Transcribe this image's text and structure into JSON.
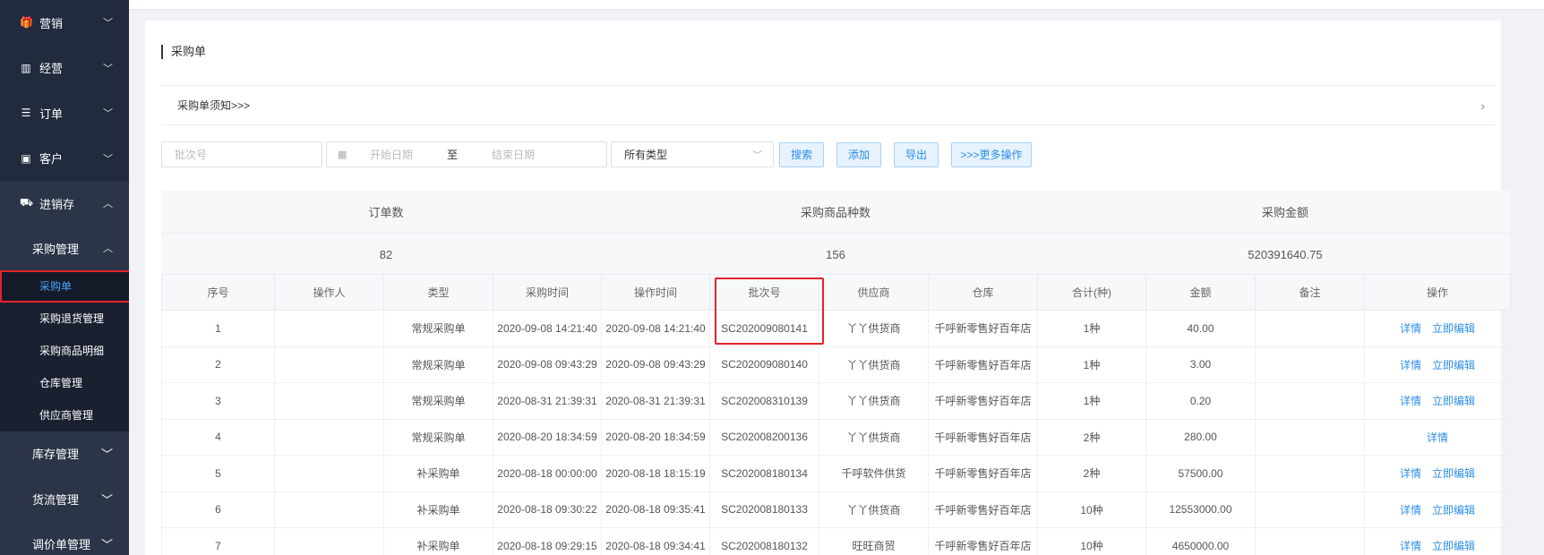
{
  "sidebar": {
    "items": [
      {
        "label": "营销",
        "icon": "gift-icon"
      },
      {
        "label": "经营",
        "icon": "bar-chart-icon"
      },
      {
        "label": "订单",
        "icon": "list-icon"
      },
      {
        "label": "客户",
        "icon": "id-card-icon"
      },
      {
        "label": "进销存",
        "icon": "truck-icon"
      }
    ],
    "purchase_group": "采购管理",
    "purchase_leaves": [
      "采购单",
      "采购退货管理",
      "采购商品明细",
      "仓库管理",
      "供应商管理"
    ],
    "bottom_groups": [
      "库存管理",
      "货流管理",
      "调价单管理"
    ]
  },
  "page": {
    "title": "采购单",
    "notice": "采购单须知>>>"
  },
  "filters": {
    "batch_placeholder": "批次号",
    "start_placeholder": "开始日期",
    "date_separator": "至",
    "end_placeholder": "结束日期",
    "type_value": "所有类型",
    "buttons": {
      "search": "搜索",
      "add": "添加",
      "export": "导出",
      "more": ">>>更多操作"
    }
  },
  "summary": {
    "headers": [
      "订单数",
      "采购商品种数",
      "采购金额"
    ],
    "values": [
      "82",
      "156",
      "520391640.75"
    ]
  },
  "table": {
    "columns": [
      "序号",
      "操作人",
      "类型",
      "采购时间",
      "操作时间",
      "批次号",
      "供应商",
      "仓库",
      "合计(种)",
      "金额",
      "备注",
      "操作"
    ],
    "rows": [
      {
        "no": "1",
        "operator": "",
        "type": "常规采购单",
        "purchase_time": "2020-09-08 14:21:40",
        "op_time": "2020-09-08 14:21:40",
        "batch": "SC202009080141",
        "supplier": "丫丫供货商",
        "warehouse": "千呼新零售好百年店",
        "total": "1种",
        "amount": "40.00",
        "remark": "",
        "op1": "详情",
        "op2": "立即编辑"
      },
      {
        "no": "2",
        "operator": "",
        "type": "常规采购单",
        "purchase_time": "2020-09-08 09:43:29",
        "op_time": "2020-09-08 09:43:29",
        "batch": "SC202009080140",
        "supplier": "丫丫供货商",
        "warehouse": "千呼新零售好百年店",
        "total": "1种",
        "amount": "3.00",
        "remark": "",
        "op1": "详情",
        "op2": "立即编辑"
      },
      {
        "no": "3",
        "operator": "",
        "type": "常规采购单",
        "purchase_time": "2020-08-31 21:39:31",
        "op_time": "2020-08-31 21:39:31",
        "batch": "SC202008310139",
        "supplier": "丫丫供货商",
        "warehouse": "千呼新零售好百年店",
        "total": "1种",
        "amount": "0.20",
        "remark": "",
        "op1": "详情",
        "op2": "立即编辑"
      },
      {
        "no": "4",
        "operator": "",
        "type": "常规采购单",
        "purchase_time": "2020-08-20 18:34:59",
        "op_time": "2020-08-20 18:34:59",
        "batch": "SC202008200136",
        "supplier": "丫丫供货商",
        "warehouse": "千呼新零售好百年店",
        "total": "2种",
        "amount": "280.00",
        "remark": "",
        "op1": "详情",
        "op2": ""
      },
      {
        "no": "5",
        "operator": "",
        "type": "补采购单",
        "purchase_time": "2020-08-18 00:00:00",
        "op_time": "2020-08-18 18:15:19",
        "batch": "SC202008180134",
        "supplier": "千呼软件供货",
        "warehouse": "千呼新零售好百年店",
        "total": "2种",
        "amount": "57500.00",
        "remark": "",
        "op1": "详情",
        "op2": "立即编辑"
      },
      {
        "no": "6",
        "operator": "",
        "type": "补采购单",
        "purchase_time": "2020-08-18 09:30:22",
        "op_time": "2020-08-18 09:35:41",
        "batch": "SC202008180133",
        "supplier": "丫丫供货商",
        "warehouse": "千呼新零售好百年店",
        "total": "10种",
        "amount": "12553000.00",
        "remark": "",
        "op1": "详情",
        "op2": "立即编辑"
      },
      {
        "no": "7",
        "operator": "",
        "type": "补采购单",
        "purchase_time": "2020-08-18 09:29:15",
        "op_time": "2020-08-18 09:34:41",
        "batch": "SC202008180132",
        "supplier": "旺旺商贸",
        "warehouse": "千呼新零售好百年店",
        "total": "10种",
        "amount": "4650000.00",
        "remark": "",
        "op1": "详情",
        "op2": "立即编辑"
      }
    ]
  },
  "colors": {
    "sidebar_bg": "#222a3d",
    "accent": "#2b8ee8",
    "highlight": "#e6222a"
  }
}
